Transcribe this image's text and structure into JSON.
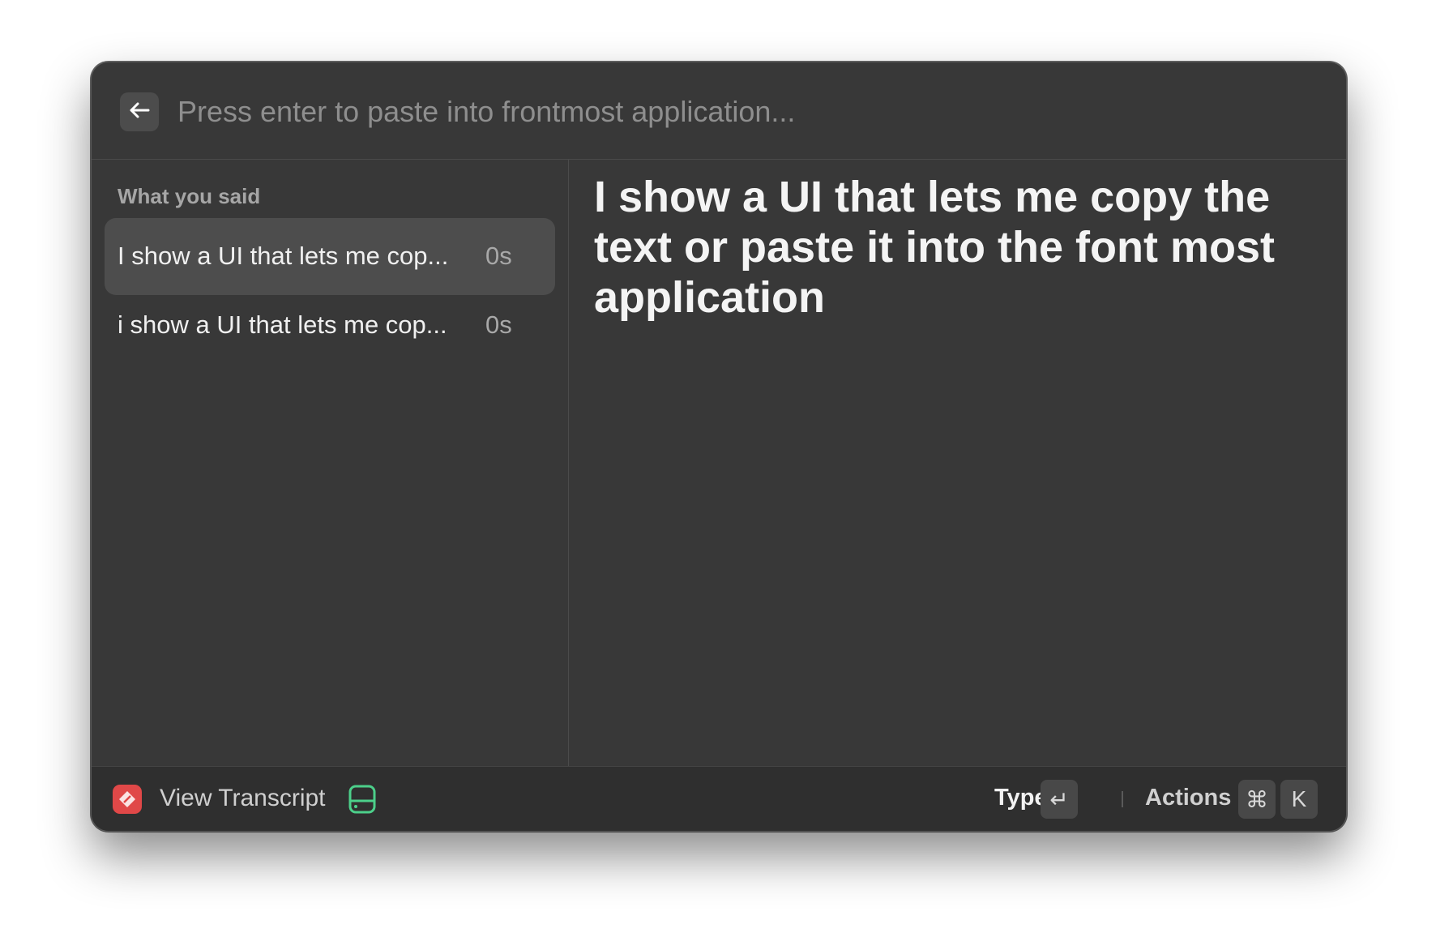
{
  "search": {
    "placeholder": "Press enter to paste into frontmost application..."
  },
  "sidebar": {
    "section_title": "What you said",
    "items": [
      {
        "text": "I show a UI that lets me cop...",
        "duration": "0s",
        "selected": true
      },
      {
        "text": "i show a UI that lets me cop...",
        "duration": "0s",
        "selected": false
      }
    ]
  },
  "detail": {
    "text": "I show a UI that lets me copy the text or paste it into the font most application"
  },
  "footer": {
    "app_icon": "app-icon",
    "view_label": "View Transcript",
    "drive_icon": "drive-icon",
    "primary_action": "Type",
    "primary_key": "↵",
    "actions_label": "Actions",
    "actions_keys": [
      "⌘",
      "K"
    ]
  },
  "colors": {
    "window_bg": "#383838",
    "footer_bg": "#2f2f2f",
    "selected_bg": "#4d4d4d",
    "app_icon_red": "#e04848",
    "drive_icon_green": "#4ccf8a"
  }
}
